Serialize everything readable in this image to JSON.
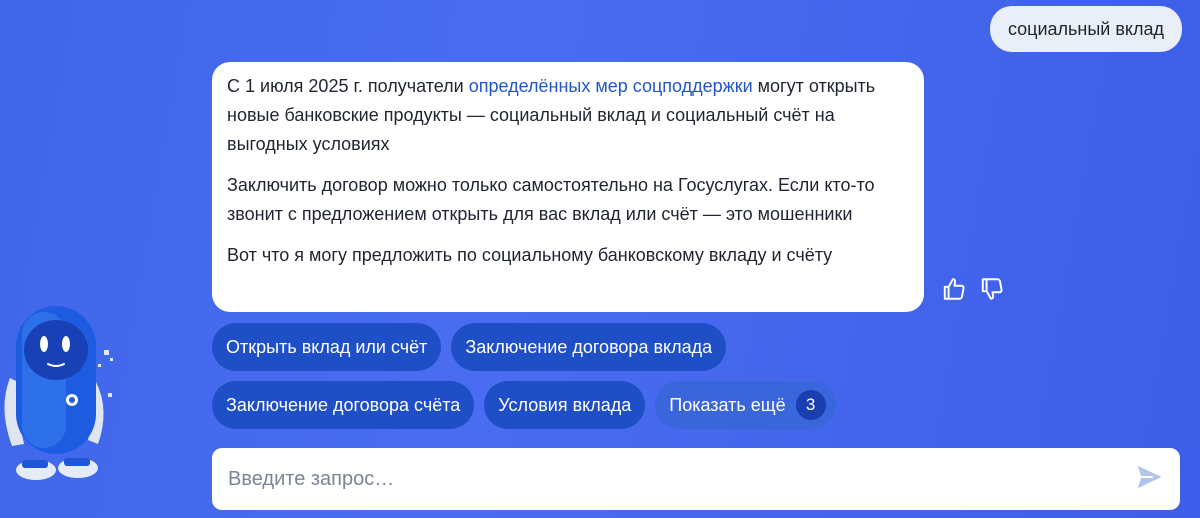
{
  "user_message": "социальный вклад",
  "bot": {
    "p1_before": "С 1 июля 2025 г. получатели ",
    "p1_link": "определённых мер соцподдержки",
    "p1_after": " могут открыть новые банковские продукты — социальный вклад и социальный счёт на выгодных условиях",
    "p2": "Заключить договор можно только самостоятельно на Госуслугах. Если кто-то звонит с предложением открыть для вас вклад или счёт — это мошенники",
    "p3": "Вот что я могу предложить по социальному банковскому вкладу и счёту"
  },
  "feedback": {
    "like_icon": "thumbs-up-icon",
    "dislike_icon": "thumbs-down-icon"
  },
  "chips": {
    "row1": [
      "Открыть вклад или счёт",
      "Заключение договора вклада"
    ],
    "row2": [
      "Заключение договора счёта",
      "Условия вклада"
    ],
    "more_label": "Показать ещё",
    "more_count": "3"
  },
  "input": {
    "placeholder": "Введите запрос…",
    "send_icon": "send-icon"
  },
  "colors": {
    "background": "#4a6df0",
    "chip": "#1e4fc6",
    "chip_more": "#3a66dc",
    "link": "#2057c9",
    "card": "#ffffff"
  },
  "assistant_avatar": "robot-mascot-icon"
}
